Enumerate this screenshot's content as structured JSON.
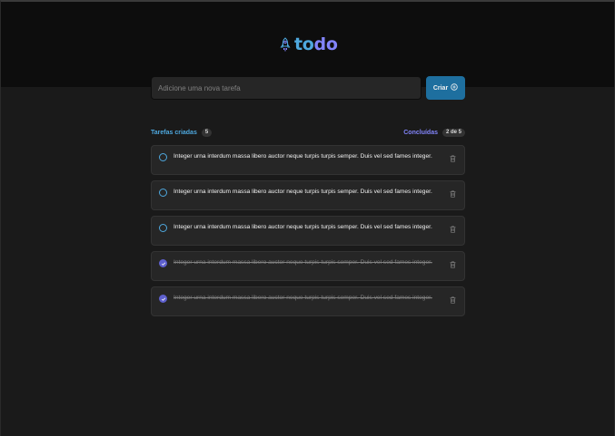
{
  "app": {
    "logo_part1": "to",
    "logo_part2": "do",
    "accent_blue": "#4ea8de",
    "accent_purple": "#8284fa"
  },
  "new_task": {
    "placeholder": "Adicione uma nova tarefa",
    "value": "",
    "create_label": "Criar",
    "create_icon": "plus-circle-icon"
  },
  "stats": {
    "created_label": "Tarefas criadas",
    "created_count": "5",
    "done_label": "Concluídas",
    "done_count": "2 de 5"
  },
  "tasks": [
    {
      "text": "Integer urna interdum massa libero auctor neque turpis turpis semper. Duis vel sed fames integer.",
      "done": false
    },
    {
      "text": "Integer urna interdum massa libero auctor neque turpis turpis semper. Duis vel sed fames integer.",
      "done": false
    },
    {
      "text": "Integer urna interdum massa libero auctor neque turpis turpis semper. Duis vel sed fames integer.",
      "done": false
    },
    {
      "text": "Integer urna interdum massa libero auctor neque turpis turpis semper. Duis vel sed fames integer.",
      "done": true
    },
    {
      "text": "Integer urna interdum massa libero auctor neque turpis turpis semper. Duis vel sed fames integer.",
      "done": true
    }
  ]
}
